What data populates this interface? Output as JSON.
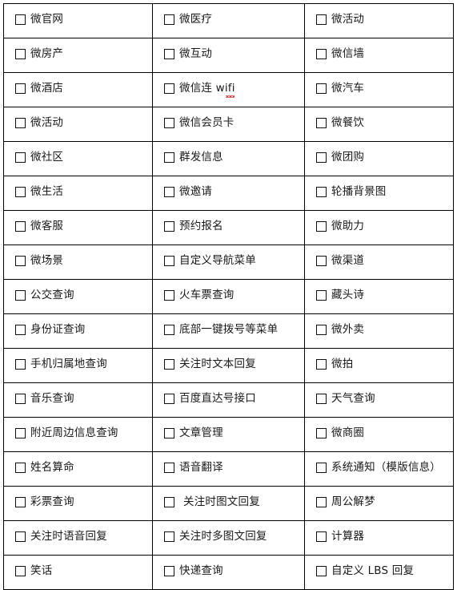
{
  "page": {
    "title": "微信公众平台功能选择表",
    "checkbox_icon": "unchecked-checkbox-icon",
    "colors": {
      "border": "#000000",
      "text": "#1a1a1a",
      "background": "#ffffff",
      "spellcheck_underline": "#e8342b"
    },
    "columns": 3,
    "rows": 17,
    "total_items": 51
  },
  "table": {
    "rows": [
      [
        {
          "label": "微官网",
          "checked": false
        },
        {
          "label": "微医疗",
          "checked": false
        },
        {
          "label": "微活动",
          "checked": false
        }
      ],
      [
        {
          "label": "微房产",
          "checked": false
        },
        {
          "label": "微互动",
          "checked": false
        },
        {
          "label": "微信墙",
          "checked": false
        }
      ],
      [
        {
          "label": "微酒店",
          "checked": false
        },
        {
          "label": "微信连 wifi",
          "checked": false,
          "spellcheck": true
        },
        {
          "label": "微汽车",
          "checked": false
        }
      ],
      [
        {
          "label": "微活动",
          "checked": false
        },
        {
          "label": "微信会员卡",
          "checked": false
        },
        {
          "label": "微餐饮",
          "checked": false
        }
      ],
      [
        {
          "label": "微社区",
          "checked": false
        },
        {
          "label": "群发信息",
          "checked": false
        },
        {
          "label": "微团购",
          "checked": false
        }
      ],
      [
        {
          "label": "微生活",
          "checked": false
        },
        {
          "label": "微邀请",
          "checked": false
        },
        {
          "label": "轮播背景图",
          "checked": false
        }
      ],
      [
        {
          "label": "微客服",
          "checked": false
        },
        {
          "label": "预约报名",
          "checked": false
        },
        {
          "label": "微助力",
          "checked": false
        }
      ],
      [
        {
          "label": "微场景",
          "checked": false
        },
        {
          "label": "自定义导航菜单",
          "checked": false
        },
        {
          "label": "微渠道",
          "checked": false
        }
      ],
      [
        {
          "label": "公交查询",
          "checked": false
        },
        {
          "label": "火车票查询",
          "checked": false
        },
        {
          "label": "藏头诗",
          "checked": false
        }
      ],
      [
        {
          "label": "身份证查询",
          "checked": false
        },
        {
          "label": "底部一键拨号等菜单",
          "checked": false
        },
        {
          "label": "微外卖",
          "checked": false
        }
      ],
      [
        {
          "label": "手机归属地查询",
          "checked": false
        },
        {
          "label": "关注时文本回复",
          "checked": false
        },
        {
          "label": "微拍",
          "checked": false
        }
      ],
      [
        {
          "label": "音乐查询",
          "checked": false
        },
        {
          "label": "百度直达号接口",
          "checked": false
        },
        {
          "label": "天气查询",
          "checked": false
        }
      ],
      [
        {
          "label": "附近周边信息查询",
          "checked": false
        },
        {
          "label": "文章管理",
          "checked": false
        },
        {
          "label": "微商圈",
          "checked": false
        }
      ],
      [
        {
          "label": "姓名算命",
          "checked": false
        },
        {
          "label": "语音翻译",
          "checked": false
        },
        {
          "label": "系统通知（模版信息）",
          "checked": false
        }
      ],
      [
        {
          "label": "彩票查询",
          "checked": false
        },
        {
          "label": "关注时图文回复",
          "checked": false,
          "indent": true
        },
        {
          "label": "周公解梦",
          "checked": false
        }
      ],
      [
        {
          "label": "关注时语音回复",
          "checked": false
        },
        {
          "label": "关注时多图文回复",
          "checked": false
        },
        {
          "label": "计算器",
          "checked": false
        }
      ],
      [
        {
          "label": "笑话",
          "checked": false
        },
        {
          "label": "快递查询",
          "checked": false
        },
        {
          "label": "自定义 LBS 回复",
          "checked": false
        }
      ]
    ]
  }
}
